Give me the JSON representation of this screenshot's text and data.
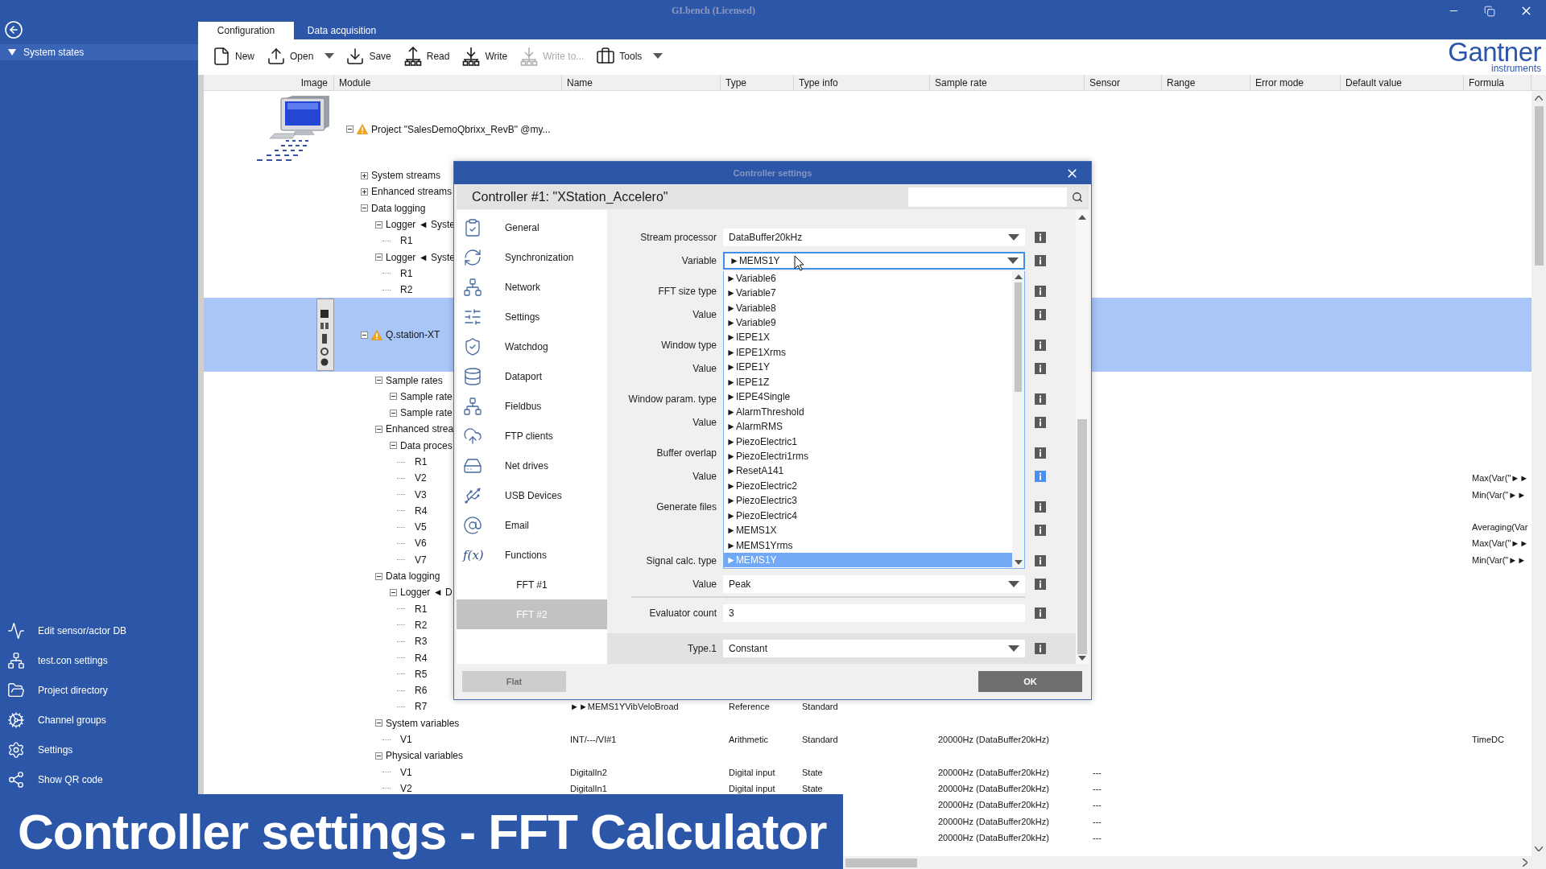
{
  "window": {
    "title": "GI.bench (Licensed)"
  },
  "sidebar": {
    "groups": [
      {
        "label": "System states",
        "expanded": true
      }
    ],
    "items": [
      {
        "label": "Edit sensor/actor DB"
      },
      {
        "label": "test.con settings"
      },
      {
        "label": "Project directory"
      },
      {
        "label": "Channel groups"
      },
      {
        "label": "Settings"
      },
      {
        "label": "Show QR code"
      }
    ]
  },
  "tabs": [
    {
      "label": "Configuration",
      "selected": true
    },
    {
      "label": "Data acquisition",
      "selected": false
    }
  ],
  "toolbar": [
    {
      "kind": "button",
      "label": "New",
      "disabled": false
    },
    {
      "kind": "button",
      "label": "Open",
      "disabled": false
    },
    {
      "kind": "menu",
      "disabled": false
    },
    {
      "kind": "button",
      "label": "Save",
      "disabled": false
    },
    {
      "kind": "button",
      "label": "Read",
      "disabled": false
    },
    {
      "kind": "button",
      "label": "Write",
      "disabled": false
    },
    {
      "kind": "button",
      "label": "Write to...",
      "disabled": true
    },
    {
      "kind": "button",
      "label": "Tools",
      "disabled": false
    },
    {
      "kind": "menu",
      "disabled": false
    }
  ],
  "logo": {
    "name": "Gantner",
    "tagline": "instruments"
  },
  "table": {
    "columns": [
      "Image",
      "Module",
      "Name",
      "Type",
      "Type info",
      "Sample rate",
      "Sensor",
      "Range",
      "Error mode",
      "Default value",
      "Formula"
    ],
    "tree": [
      {
        "kind": "project",
        "label": "Project \"SalesDemoQbrixx_RevB\" @my...",
        "warning": true,
        "expanded": true,
        "selected": false,
        "children": [
          {
            "kind": "folder",
            "label": "System streams",
            "expanded": false,
            "selected": false
          },
          {
            "kind": "folder",
            "label": "Enhanced streams",
            "expanded": false,
            "selected": false
          },
          {
            "kind": "folder",
            "label": "Data logging",
            "expanded": true,
            "selected": false,
            "children": [
              {
                "kind": "folder",
                "label": "Logger ◄ Syste",
                "expanded": true,
                "selected": false,
                "children": [
                  {
                    "kind": "leaf",
                    "label": "R1",
                    "selected": false
                  }
                ]
              },
              {
                "kind": "folder",
                "label": "Logger ◄ Syste",
                "expanded": true,
                "selected": false,
                "children": [
                  {
                    "kind": "leaf",
                    "label": "R1",
                    "selected": false
                  },
                  {
                    "kind": "leaf",
                    "label": "R2",
                    "selected": false
                  }
                ]
              }
            ]
          },
          {
            "kind": "controller",
            "label": "Q.station-XT",
            "warning": true,
            "expanded": true,
            "selected": true,
            "children": [
              {
                "kind": "folder",
                "label": "Sample rates",
                "expanded": true,
                "selected": false,
                "children": [
                  {
                    "kind": "folder",
                    "label": "Sample rate",
                    "expanded": true,
                    "selected": false
                  },
                  {
                    "kind": "folder",
                    "label": "Sample rate",
                    "expanded": true,
                    "selected": false
                  }
                ]
              },
              {
                "kind": "folder",
                "label": "Enhanced strea",
                "expanded": true,
                "selected": false,
                "children": [
                  {
                    "kind": "folder",
                    "label": "Data proces",
                    "expanded": true,
                    "selected": false,
                    "children": [
                      {
                        "kind": "leaf",
                        "label": "R1",
                        "selected": false
                      },
                      {
                        "kind": "leaf",
                        "label": "V2",
                        "selected": false,
                        "cells": {
                          "formula": "Max(Var(\"►►"
                        }
                      },
                      {
                        "kind": "leaf",
                        "label": "V3",
                        "selected": false,
                        "cells": {
                          "formula": "Min(Var(\"►►"
                        }
                      },
                      {
                        "kind": "leaf",
                        "label": "R4",
                        "selected": false
                      },
                      {
                        "kind": "leaf",
                        "label": "V5",
                        "selected": false,
                        "cells": {
                          "formula": "Averaging(Var"
                        }
                      },
                      {
                        "kind": "leaf",
                        "label": "V6",
                        "selected": false,
                        "cells": {
                          "formula": "Max(Var(\"►►"
                        }
                      },
                      {
                        "kind": "leaf",
                        "label": "V7",
                        "selected": false,
                        "cells": {
                          "formula": "Min(Var(\"►►"
                        }
                      }
                    ]
                  }
                ]
              },
              {
                "kind": "folder",
                "label": "Data logging",
                "expanded": true,
                "selected": false,
                "children": [
                  {
                    "kind": "folder",
                    "label": "Logger ◄ D",
                    "expanded": true,
                    "selected": false,
                    "children": [
                      {
                        "kind": "leaf",
                        "label": "R1",
                        "selected": false
                      },
                      {
                        "kind": "leaf",
                        "label": "R2",
                        "selected": false
                      },
                      {
                        "kind": "leaf",
                        "label": "R3",
                        "selected": false
                      },
                      {
                        "kind": "leaf",
                        "label": "R4",
                        "selected": false
                      },
                      {
                        "kind": "leaf",
                        "label": "R5",
                        "selected": false
                      },
                      {
                        "kind": "leaf",
                        "label": "R6",
                        "selected": false
                      },
                      {
                        "kind": "leaf",
                        "label": "R7",
                        "selected": false,
                        "cells": {
                          "name": "►►MEMS1YVibVeloBroad",
                          "type": "Reference",
                          "type_info": "Standard"
                        }
                      }
                    ]
                  }
                ]
              },
              {
                "kind": "folder",
                "label": "System variables",
                "expanded": true,
                "selected": false,
                "children": [
                  {
                    "kind": "leaf",
                    "label": "V1",
                    "selected": false,
                    "cells": {
                      "name": "INT/---/VI#1",
                      "type": "Arithmetic",
                      "type_info": "Standard",
                      "sample_rate": "20000Hz (DataBuffer20kHz)",
                      "formula": "TimeDC"
                    }
                  }
                ]
              },
              {
                "kind": "folder",
                "label": "Physical variables",
                "expanded": true,
                "selected": false,
                "children": [
                  {
                    "kind": "leaf",
                    "label": "V1",
                    "selected": false,
                    "cells": {
                      "name": "DigitalIn2",
                      "type": "Digital input",
                      "type_info": "State",
                      "sample_rate": "20000Hz (DataBuffer20kHz)",
                      "sensor": "---"
                    }
                  },
                  {
                    "kind": "leaf",
                    "label": "V2",
                    "selected": false,
                    "cells": {
                      "name": "DigitalIn1",
                      "type": "Digital input",
                      "type_info": "State",
                      "sample_rate": "20000Hz (DataBuffer20kHz)",
                      "sensor": "---"
                    }
                  },
                  {
                    "kind": "leaf",
                    "selected": false,
                    "cells": {
                      "sample_rate": "20000Hz (DataBuffer20kHz)",
                      "sensor": "---"
                    }
                  },
                  {
                    "kind": "leaf",
                    "selected": false,
                    "cells": {
                      "sample_rate": "20000Hz (DataBuffer20kHz)",
                      "sensor": "---"
                    }
                  },
                  {
                    "kind": "leaf",
                    "selected": false,
                    "cells": {
                      "sample_rate": "20000Hz (DataBuffer20kHz)",
                      "sensor": "---"
                    }
                  }
                ]
              }
            ]
          }
        ]
      }
    ]
  },
  "dialog": {
    "title": "Controller settings",
    "heading": "Controller #1: \"XStation_Accelero\"",
    "nav": [
      {
        "kind": "category",
        "label": "General",
        "selected": false
      },
      {
        "kind": "category",
        "label": "Synchronization",
        "selected": false
      },
      {
        "kind": "category",
        "label": "Network",
        "selected": false
      },
      {
        "kind": "category",
        "label": "Settings",
        "selected": false
      },
      {
        "kind": "category",
        "label": "Watchdog",
        "selected": false
      },
      {
        "kind": "category",
        "label": "Dataport",
        "selected": false
      },
      {
        "kind": "category",
        "label": "Fieldbus",
        "selected": false
      },
      {
        "kind": "category",
        "label": "FTP clients",
        "selected": false
      },
      {
        "kind": "category",
        "label": "Net drives",
        "selected": false
      },
      {
        "kind": "category",
        "label": "USB Devices",
        "selected": false
      },
      {
        "kind": "category",
        "label": "Email",
        "selected": false
      },
      {
        "kind": "category",
        "label": "Functions",
        "glyph": "f(x)",
        "selected": false
      },
      {
        "kind": "instance",
        "label": "FFT #1",
        "selected": false
      },
      {
        "kind": "instance",
        "label": "FFT #2",
        "selected": true
      }
    ],
    "form": {
      "groups": [
        [
          {
            "kind": "select",
            "label": "Stream processor",
            "value": "DataBuffer20kHz",
            "open": false,
            "info_highlighted": false
          },
          {
            "kind": "select",
            "label": "Variable",
            "value": "►MEMS1Y",
            "open": true,
            "info_highlighted": false,
            "options": [
              {
                "label": "►Variable6",
                "selected": false
              },
              {
                "label": "►Variable7",
                "selected": false
              },
              {
                "label": "►Variable8",
                "selected": false
              },
              {
                "label": "►Variable9",
                "selected": false
              },
              {
                "label": "►IEPE1X",
                "selected": false
              },
              {
                "label": "►IEPE1Xrms",
                "selected": false
              },
              {
                "label": "►IEPE1Y",
                "selected": false
              },
              {
                "label": "►IEPE1Z",
                "selected": false
              },
              {
                "label": "►IEPE4Single",
                "selected": false
              },
              {
                "label": "►AlarmThreshold",
                "selected": false
              },
              {
                "label": "►AlarmRMS",
                "selected": false
              },
              {
                "label": "►PiezoElectric1",
                "selected": false
              },
              {
                "label": "►PiezoElectri1rms",
                "selected": false
              },
              {
                "label": "►ResetA141",
                "selected": false
              },
              {
                "label": "►PiezoElectric2",
                "selected": false
              },
              {
                "label": "►PiezoElectric3",
                "selected": false
              },
              {
                "label": "►PiezoElectric4",
                "selected": false
              },
              {
                "label": "►MEMS1X",
                "selected": false
              },
              {
                "label": "►MEMS1Yrms",
                "selected": false
              },
              {
                "label": "►MEMS1Y",
                "selected": true
              }
            ]
          }
        ],
        [
          {
            "kind": "covered",
            "label": "FFT size type",
            "info_highlighted": false
          },
          {
            "kind": "covered",
            "label": "Value",
            "info_highlighted": false
          }
        ],
        [
          {
            "kind": "covered",
            "label": "Window type",
            "info_highlighted": false
          },
          {
            "kind": "covered",
            "label": "Value",
            "info_highlighted": false
          }
        ],
        [
          {
            "kind": "covered",
            "label": "Window param. type",
            "info_highlighted": false
          },
          {
            "kind": "covered",
            "label": "Value",
            "info_highlighted": false
          }
        ],
        [
          {
            "kind": "covered",
            "label": "Buffer overlap",
            "info_highlighted": false
          },
          {
            "kind": "covered",
            "label": "Value",
            "info_highlighted": true
          }
        ],
        [
          {
            "kind": "covered",
            "label": "Generate files",
            "info_highlighted": false
          },
          {
            "kind": "covered",
            "info_highlighted": false
          }
        ],
        [
          {
            "kind": "covered",
            "label": "Signal calc. type",
            "info_highlighted": false
          },
          {
            "kind": "select",
            "label": "Value",
            "value": "Peak",
            "open": false,
            "info_highlighted": false
          }
        ]
      ],
      "summary": [
        {
          "kind": "input",
          "label": "Evaluator count",
          "value": "3",
          "info_highlighted": false
        }
      ],
      "section": [
        {
          "kind": "select",
          "label": "Type.1",
          "value": "Constant",
          "open": false,
          "info_highlighted": false
        }
      ]
    },
    "buttons": [
      {
        "label": "Flat",
        "disabled": true
      },
      {
        "label": "OK",
        "disabled": false
      }
    ]
  },
  "caption": {
    "text": "Controller settings - FFT Calculator"
  }
}
